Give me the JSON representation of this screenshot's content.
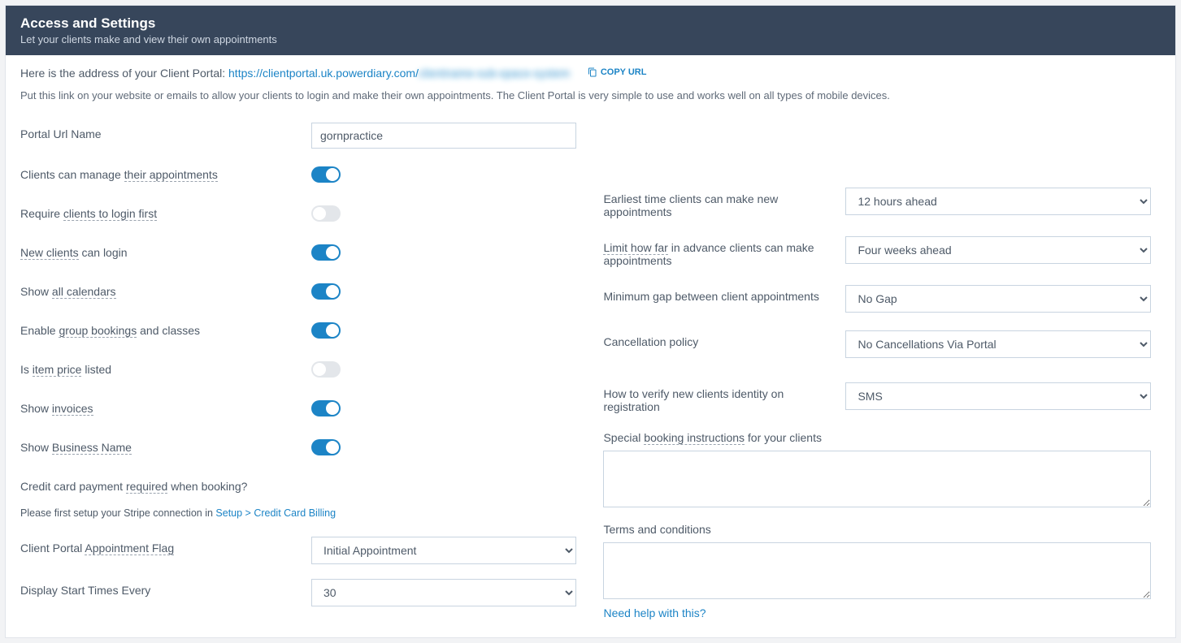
{
  "header": {
    "title": "Access and Settings",
    "subtitle": "Let your clients make and view their own appointments"
  },
  "intro": {
    "prefix": "Here is the address of your Client Portal: ",
    "url_visible": "https://clientportal.uk.powerdiary.com/",
    "url_hidden": "clientname-sub-space-system",
    "copy_label": "COPY URL",
    "description": "Put this link on your website or emails to allow your clients to login and make their own appointments. The Client Portal is very simple to use and works well on all types of mobile devices."
  },
  "left": {
    "portal_url_name": {
      "label": "Portal Url Name",
      "value": "gornpractice"
    },
    "manage_appts": {
      "pre": "Clients can manage ",
      "dotted": "their appointments",
      "on": true
    },
    "require_login": {
      "pre": "Require ",
      "dotted": "clients to login first",
      "on": false
    },
    "new_clients": {
      "dotted": "New clients",
      "post": " can login",
      "on": true
    },
    "show_calendars": {
      "pre": "Show ",
      "dotted": "all calendars",
      "on": true
    },
    "group_bookings": {
      "pre": "Enable ",
      "dotted": "group bookings",
      "post": " and classes",
      "on": true
    },
    "item_price": {
      "pre": "Is ",
      "dotted": "item price",
      "post": " listed",
      "on": false
    },
    "show_invoices": {
      "pre": "Show ",
      "dotted": "invoices",
      "on": true
    },
    "show_business": {
      "pre": "Show ",
      "dotted": "Business Name",
      "on": true
    },
    "cc_required": {
      "pre": "Credit card payment ",
      "dotted": "required",
      "post": " when booking?"
    },
    "stripe_note": {
      "pre": "Please first setup your Stripe connection in ",
      "link": "Setup > Credit Card Billing"
    },
    "appt_flag": {
      "pre": "Client Portal ",
      "dotted": "Appointment Flag",
      "value": "Initial Appointment"
    },
    "display_start": {
      "label": "Display Start Times Every",
      "value": "30"
    }
  },
  "right": {
    "earliest": {
      "label": "Earliest time clients can make new appointments",
      "value": "12 hours ahead"
    },
    "limit_far": {
      "dotted": "Limit how far",
      "post": " in advance clients can make appointments",
      "value": "Four weeks ahead"
    },
    "min_gap": {
      "label": "Minimum gap between client appointments",
      "value": "No Gap"
    },
    "cancel_policy": {
      "label": "Cancellation policy",
      "value": "No Cancellations Via Portal"
    },
    "verify": {
      "label": "How to verify new clients identity on registration",
      "value": "SMS"
    },
    "special": {
      "pre": "Special ",
      "dotted": "booking instructions",
      "post": " for your clients",
      "value": ""
    },
    "terms": {
      "label": "Terms and conditions",
      "value": ""
    },
    "help_link": "Need help with this?"
  }
}
